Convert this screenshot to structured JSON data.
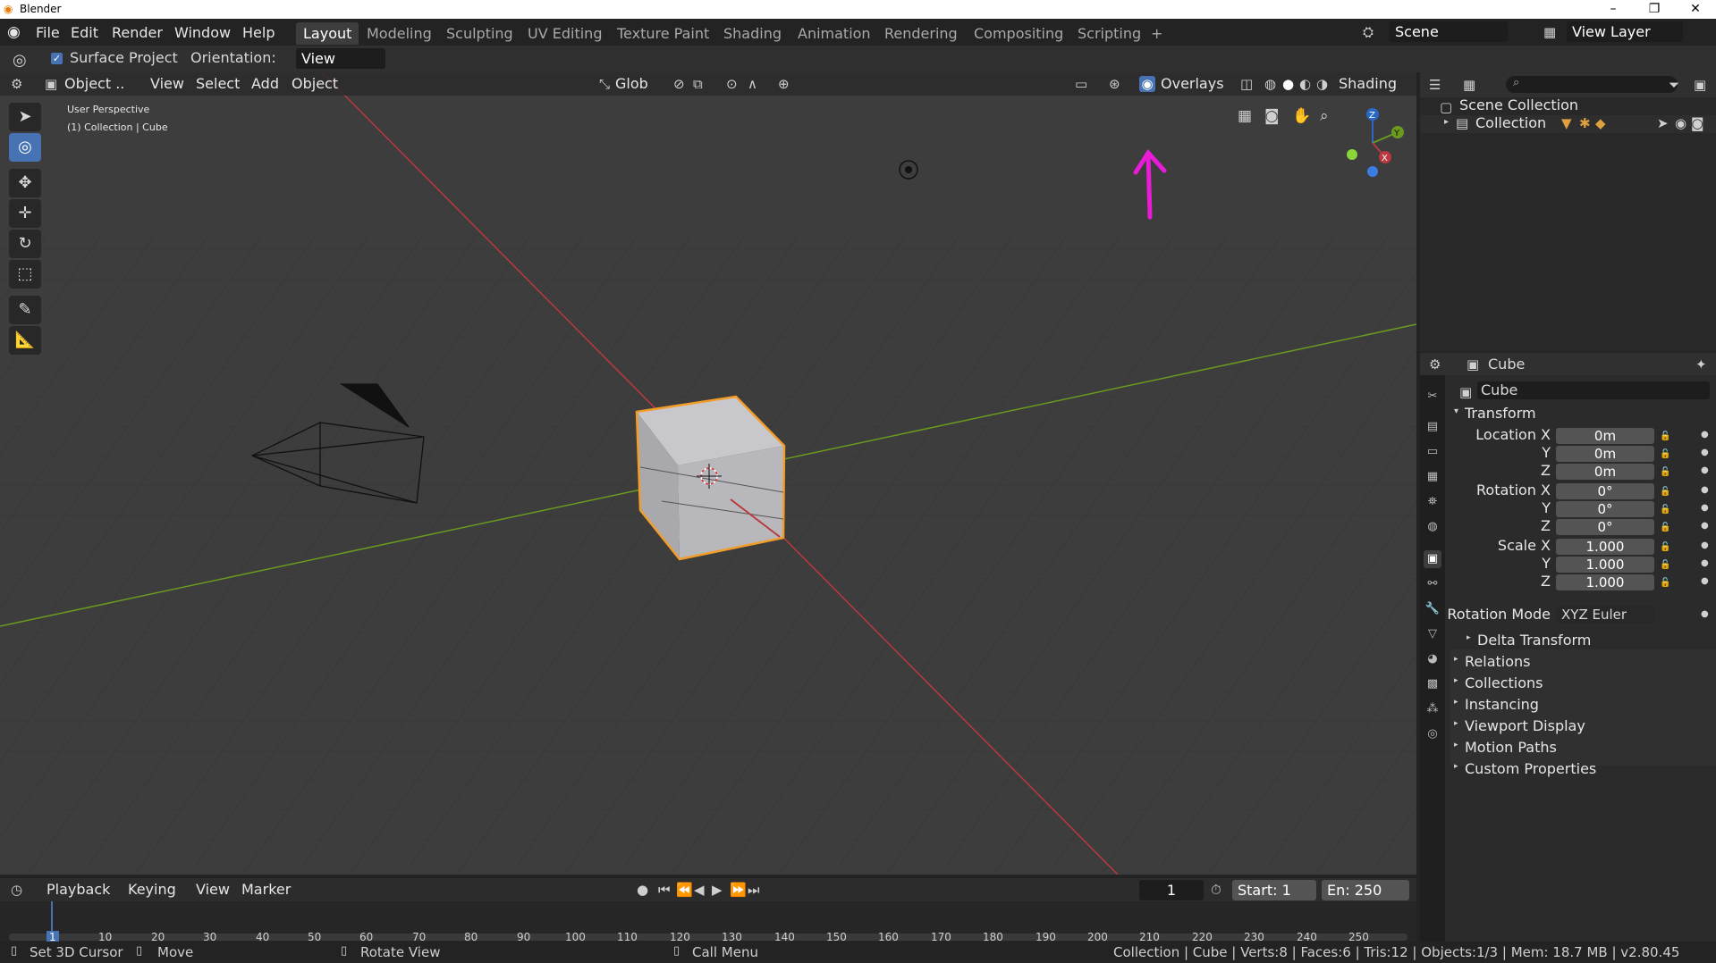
{
  "window": {
    "title": "Blender",
    "min": "–",
    "max": "❐",
    "close": "✕"
  },
  "menu": [
    "File",
    "Edit",
    "Render",
    "Window",
    "Help"
  ],
  "workspaces": [
    "Layout",
    "Modeling",
    "Sculpting",
    "UV Editing",
    "Texture Paint",
    "Shading",
    "Animation",
    "Rendering",
    "Compositing",
    "Scripting",
    "+"
  ],
  "scene": {
    "label": "Scene",
    "view_layer": "View Layer"
  },
  "tool_settings": {
    "surface_project": "Surface Project",
    "orientation_label": "Orientation:",
    "orientation_value": "View"
  },
  "viewport_header": {
    "mode": "Object ..",
    "menus": [
      "View",
      "Select",
      "Add",
      "Object"
    ],
    "transform_orient": "Glob",
    "overlays": "Overlays",
    "shading": "Shading"
  },
  "viewport_overlay": {
    "view_name": "User Perspective",
    "context": "(1) Collection | Cube"
  },
  "gizmo_axes": {
    "z": "Z",
    "y": "Y",
    "x": "X"
  },
  "outliner": {
    "scene_collection": "Scene Collection",
    "collection": "Collection"
  },
  "properties": {
    "header": "Cube",
    "object_name": "Cube",
    "transform_title": "Transform",
    "location": {
      "label": "Location X",
      "x": "0m",
      "y": "0m",
      "z": "0m"
    },
    "rotation": {
      "label": "Rotation X",
      "x": "0°",
      "y": "0°",
      "z": "0°"
    },
    "scale": {
      "label": "Scale X",
      "x": "1.000",
      "y": "1.000",
      "z": "1.000"
    },
    "axis_y": "Y",
    "axis_z": "Z",
    "rotation_mode_label": "Rotation Mode",
    "rotation_mode_value": "XYZ Euler",
    "delta": "Delta Transform",
    "sections": [
      "Relations",
      "Collections",
      "Instancing",
      "Viewport Display",
      "Motion Paths",
      "Custom Properties"
    ]
  },
  "timeline": {
    "menus": [
      "Playback",
      "Keying",
      "View",
      "Marker"
    ],
    "current_frame": "1",
    "start": "Start:",
    "start_val": "1",
    "end": "En:",
    "end_val": "250",
    "ticks": [
      "1",
      "10",
      "20",
      "30",
      "40",
      "50",
      "60",
      "70",
      "80",
      "90",
      "100",
      "110",
      "120",
      "130",
      "140",
      "150",
      "160",
      "170",
      "180",
      "190",
      "200",
      "210",
      "220",
      "230",
      "240",
      "250"
    ]
  },
  "status": {
    "left1": "Set 3D Cursor",
    "left2": "Move",
    "mid": "Rotate View",
    "menu": "Call Menu",
    "info": "Collection | Cube | Verts:8 | Faces:6 | Tris:12 | Objects:1/3 | Mem: 18.7 MB | v2.80.45"
  },
  "colors": {
    "accent": "#4772b3",
    "selection_outline": "#f29d29",
    "x_axis": "#b9393f",
    "y_axis": "#6a9a1f",
    "annotation_arrow": "#e81bd6"
  }
}
